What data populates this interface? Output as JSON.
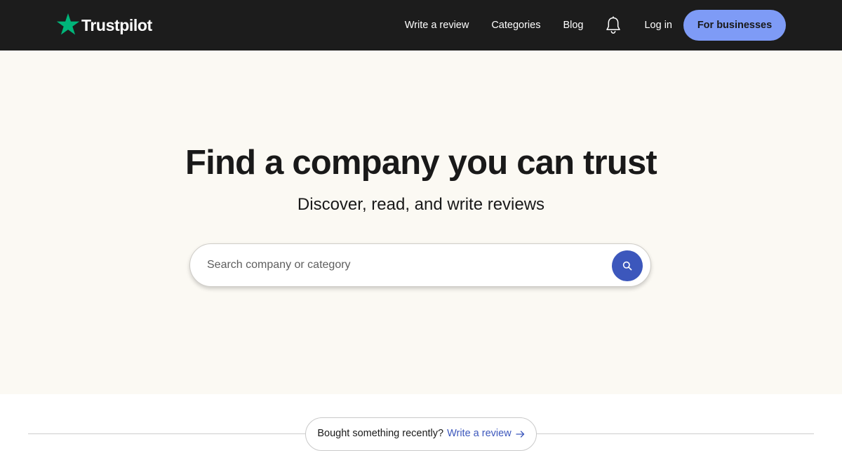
{
  "header": {
    "logo_text": "Trustpilot",
    "nav": {
      "write_review": "Write a review",
      "categories": "Categories",
      "blog": "Blog",
      "login": "Log in",
      "for_businesses": "For businesses"
    },
    "icons": {
      "logo": "star-icon",
      "notifications": "bell-icon"
    }
  },
  "hero": {
    "title": "Find a company you can trust",
    "subtitle": "Discover, read, and write reviews",
    "search": {
      "placeholder": "Search company or category",
      "value": "",
      "button_icon": "search-icon"
    }
  },
  "bottom": {
    "prompt_text": "Bought something recently?",
    "link_text": "Write a review",
    "link_icon": "arrow-right-icon"
  },
  "colors": {
    "header_bg": "#1c1c1c",
    "hero_bg": "#fbf9f3",
    "brand_green": "#00b67a",
    "business_button": "#7e9bf6",
    "search_button": "#3c57bc",
    "link_blue": "#3c57bc"
  }
}
